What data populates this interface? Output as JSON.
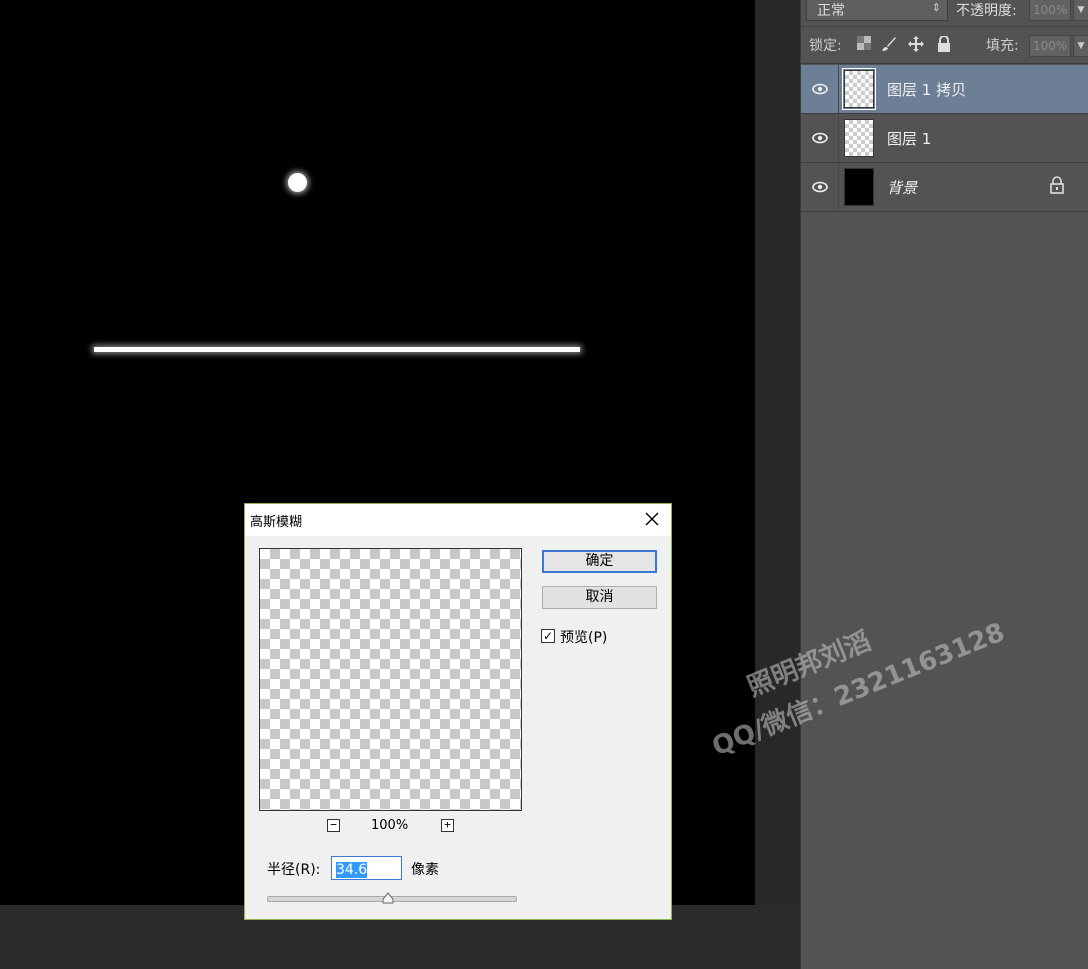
{
  "layers_panel": {
    "blend_mode": "正常",
    "opacity_label": "不透明度:",
    "opacity_value": "100%",
    "lock_label": "锁定:",
    "fill_label": "填充:",
    "fill_value": "100%",
    "layers": [
      {
        "name": "图层 1 拷贝",
        "selected": true,
        "thumbnail": "transparent",
        "visible": true
      },
      {
        "name": "图层 1",
        "selected": false,
        "thumbnail": "transparent",
        "visible": true
      },
      {
        "name": "背景",
        "selected": false,
        "thumbnail": "black",
        "visible": true,
        "locked": true
      }
    ]
  },
  "watermark": {
    "line1": "照明邦刘滔",
    "line2": "QQ/微信：2321163128"
  },
  "dialog": {
    "title": "高斯模糊",
    "ok_label": "确定",
    "cancel_label": "取消",
    "preview_label": "预览(P)",
    "preview_checked": true,
    "zoom_out_symbol": "−",
    "zoom_in_symbol": "+",
    "zoom_level": "100%",
    "radius_label": "半径(R):",
    "radius_value": "34.6",
    "radius_unit": "像素"
  },
  "colors": {
    "selected_layer": "#6d7f96",
    "dialog_border": "#8fb44d",
    "accent_blue": "#3b78d3"
  }
}
